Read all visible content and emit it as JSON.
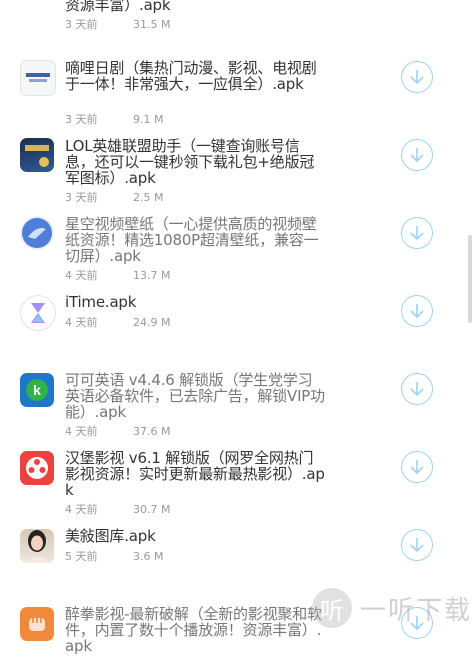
{
  "apps": [
    {
      "title": "资源丰富）.apk",
      "time": "3 天前",
      "size": "31.5 M"
    },
    {
      "title": "嘀哩日剧（集热门动漫、影视、电视剧于一体！非常强大，一应俱全）.apk",
      "time": "3 天前",
      "size": "9.1 M",
      "icon": "dilidili-app-icon"
    },
    {
      "title": "LOL英雄联盟助手（一键查询账号信息，还可以一键秒领下载礼包+绝版冠军图标）.apk",
      "time": "3 天前",
      "size": "2.5 M",
      "icon": "lol-app-icon"
    },
    {
      "title": "星空视频壁纸（一心提供高质的视频壁纸资源！精选1080P超清壁纸，兼容一切屏）.apk",
      "time": "4 天前",
      "size": "13.7 M",
      "icon": "starry-wallpaper-app-icon"
    },
    {
      "title": "iTime.apk",
      "time": "4 天前",
      "size": "24.9 M",
      "icon": "hourglass-app-icon"
    },
    {
      "title": "可可英语 v4.4.6 解锁版（学生党学习英语必备软件，已去除广告，解锁VIP功能）.apk",
      "time": "4 天前",
      "size": "37.6 M",
      "icon": "keke-english-app-icon"
    },
    {
      "title": "汉堡影视 v6.1 解锁版（网罗全网热门影视资源！实时更新最新最热影视）.apk",
      "time": "4 天前",
      "size": "30.7 M",
      "icon": "hamburger-video-app-icon"
    },
    {
      "title": "美敍图库.apk",
      "time": "5 天前",
      "size": "3.6 M",
      "icon": "portrait-app-icon"
    },
    {
      "title": "醉拳影视-最新破解（全新的影视聚和软件，内置了数十个播放源！资源丰富）.apk",
      "time": "",
      "size": "",
      "icon": "fist-app-icon"
    }
  ],
  "watermark": {
    "text": "一听下载",
    "logo_glyph": "听"
  },
  "colors": {
    "accent": "#9ed4f0",
    "title_text": "#333333",
    "meta_text": "#999999"
  }
}
